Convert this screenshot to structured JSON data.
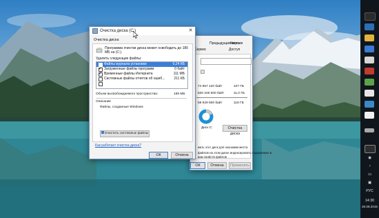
{
  "cleanup_dialog": {
    "title": "Очистка диска (C:)",
    "tab": "Очистка диска",
    "intro": "Программа очистки диска может освободить до 180 МБ на (C:).",
    "delete_label": "Удалить следующие файлы:",
    "files": [
      {
        "name": "Файлы журнала установки",
        "size": "0,24 КБ",
        "checked": false,
        "selected": true
      },
      {
        "name": "Загруженные файлы программ",
        "size": "0 байт",
        "checked": true,
        "selected": false
      },
      {
        "name": "Временные файлы Интернета",
        "size": "111 МБ",
        "checked": true,
        "selected": false
      },
      {
        "name": "Системные файлы отчетов об ошиб...",
        "size": "211 КБ",
        "checked": false,
        "selected": false
      },
      {
        "name": "",
        "size": "",
        "checked": false,
        "selected": false
      }
    ],
    "total_label": "Объем высвобождаемого пространства:",
    "total_value": "185 МБ",
    "description_label": "Описание",
    "description_text": "Файлы, созданные Windows",
    "cleanup_system_button": "Очистить системные файлы",
    "help_link": "Как работает очистка диска?",
    "ok_button": "ОК",
    "cancel_button": "Отмена"
  },
  "properties_dialog": {
    "tabs_top": [
      "Предыдущие версии",
      "Квота"
    ],
    "tabs_bottom": [
      "Сервис",
      "Доступ"
    ],
    "used_bytes": "74 957 120 байт",
    "used_size": "107 ГБ",
    "free_bytes": "520 249 600 байт",
    "free_size": "11,0 ГБ",
    "capacity_bytes": "59 929 600 байт",
    "capacity_size": "118 ГБ",
    "drive_label": "Диск C:",
    "cleanup_button": "Очистка диска",
    "compress_text": "жать этот диск для экономии места",
    "index_text": "файлов на этом диске индексировать содержимое в",
    "index_text2": "вам свойств файлов",
    "ok_button": "ОК",
    "cancel_button": "Отмена",
    "apply_button": "Применить",
    "accent_color": "#1e90d6"
  },
  "taskbar": {
    "language": "РУС",
    "time": "14:30",
    "date": "26.08.2015"
  }
}
